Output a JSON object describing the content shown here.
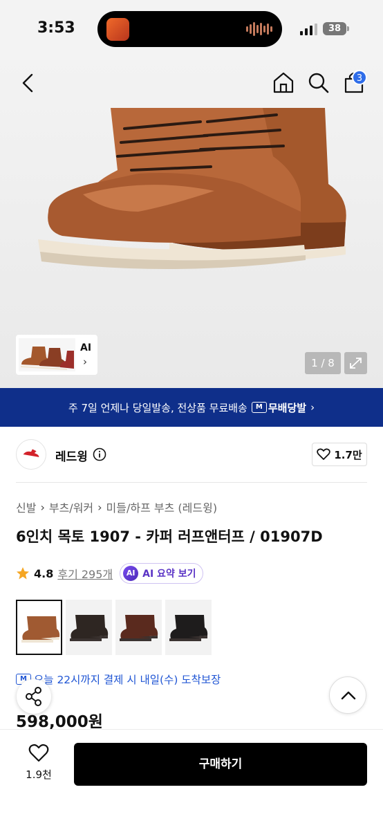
{
  "status_bar": {
    "time": "3:53",
    "battery": "38"
  },
  "nav": {
    "cart_count": "3"
  },
  "gallery": {
    "ai_label": "AI",
    "ai_chevron": "›",
    "pager": "1 / 8"
  },
  "banner": {
    "text": "주 7일 언제나 당일발송, 전상품 무료배송",
    "badge_icon": "M",
    "badge_label": "무배당발",
    "chevron": "›"
  },
  "brand": {
    "name": "레드윙",
    "likes": "1.7만"
  },
  "breadcrumb": {
    "items": [
      "신발",
      "부츠/워커",
      "미들/하프 부츠 (레드윙)"
    ],
    "sep": "›"
  },
  "product": {
    "title": "6인치 목토 1907 - 카퍼 러프앤터프 / 01907D",
    "rating": "4.8",
    "reviews": "후기 295개",
    "ai_chip_icon": "AI",
    "ai_chip_label": "AI 요약 보기",
    "swatch_colors": [
      "#a05a32",
      "#2e2622",
      "#5a2a1e",
      "#1e1c1c"
    ],
    "delivery_icon": "M",
    "delivery": "오늘 22시까지 결제 시 내일(수) 도착보장",
    "price": "598,000원"
  },
  "bottom_bar": {
    "wish_count": "1.9천",
    "buy_label": "구매하기"
  },
  "colors": {
    "accent_blue": "#2f6de9",
    "banner_navy": "#0f2f8a",
    "star": "#f5a623"
  }
}
